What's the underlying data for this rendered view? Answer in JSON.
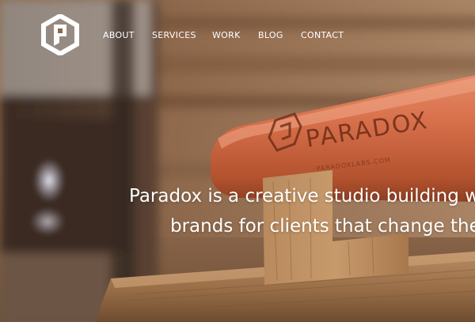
{
  "brand": {
    "logo_icon": "paradox-hexagon-logo-icon",
    "engraved_text": "PARADOX",
    "engraved_small_text": "PARADOXLABS.COM"
  },
  "nav": {
    "items": [
      {
        "label": "ABOUT"
      },
      {
        "label": "SERVICES"
      },
      {
        "label": "WORK"
      },
      {
        "label": "BLOG"
      },
      {
        "label": "CONTACT"
      }
    ]
  },
  "hero": {
    "tagline_line1": "Paradox is a creative studio building we",
    "tagline_line2": "brands for clients that change the"
  },
  "colors": {
    "nav_text": "#ffffff",
    "tagline_text": "#ffffff",
    "bat_orange": "#d86e4a",
    "wood": "#a6784d",
    "background_dark": "#2a1d14"
  }
}
